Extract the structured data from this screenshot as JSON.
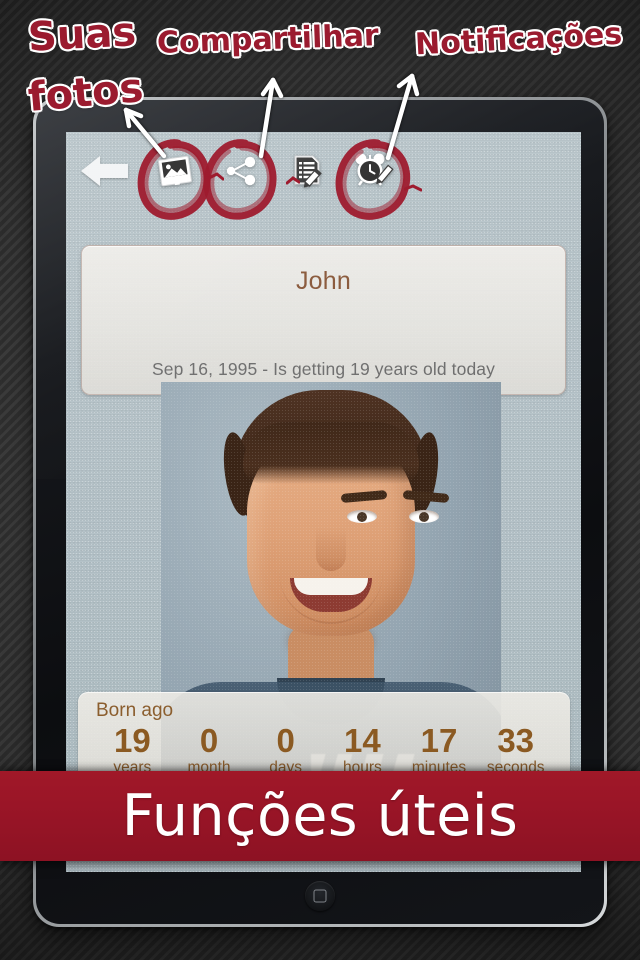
{
  "annotations": {
    "photos_line1": "Suas",
    "photos_line2": "fotos",
    "share": "Compartilhar",
    "notifications": "Notificações"
  },
  "banner": {
    "text": "Funções úteis"
  },
  "toolbar": {
    "back_label": "Back",
    "items": [
      {
        "name": "photos",
        "icon": "photo-icon",
        "circled": true
      },
      {
        "name": "share",
        "icon": "share-icon",
        "circled": true
      },
      {
        "name": "notes",
        "icon": "note-edit-icon",
        "circled": false
      },
      {
        "name": "notifications",
        "icon": "alarm-clock-icon",
        "circled": true
      }
    ]
  },
  "card": {
    "name": "John",
    "subtitle": "Sep 16, 1995 - Is getting 19 years old today"
  },
  "countdown": {
    "label": "Born ago",
    "cells": [
      {
        "value": "19",
        "unit": "years"
      },
      {
        "value": "0",
        "unit": "month"
      },
      {
        "value": "0",
        "unit": "days"
      },
      {
        "value": "14",
        "unit": "hours"
      },
      {
        "value": "17",
        "unit": "minutes"
      },
      {
        "value": "33",
        "unit": "seconds"
      }
    ]
  },
  "colors": {
    "annotation_red": "#9b1b2f",
    "banner_red": "#9a1527",
    "accent_brown": "#8b5a22",
    "name_brown": "#8a5a3c",
    "screen_bg": "#b3c1c7"
  }
}
